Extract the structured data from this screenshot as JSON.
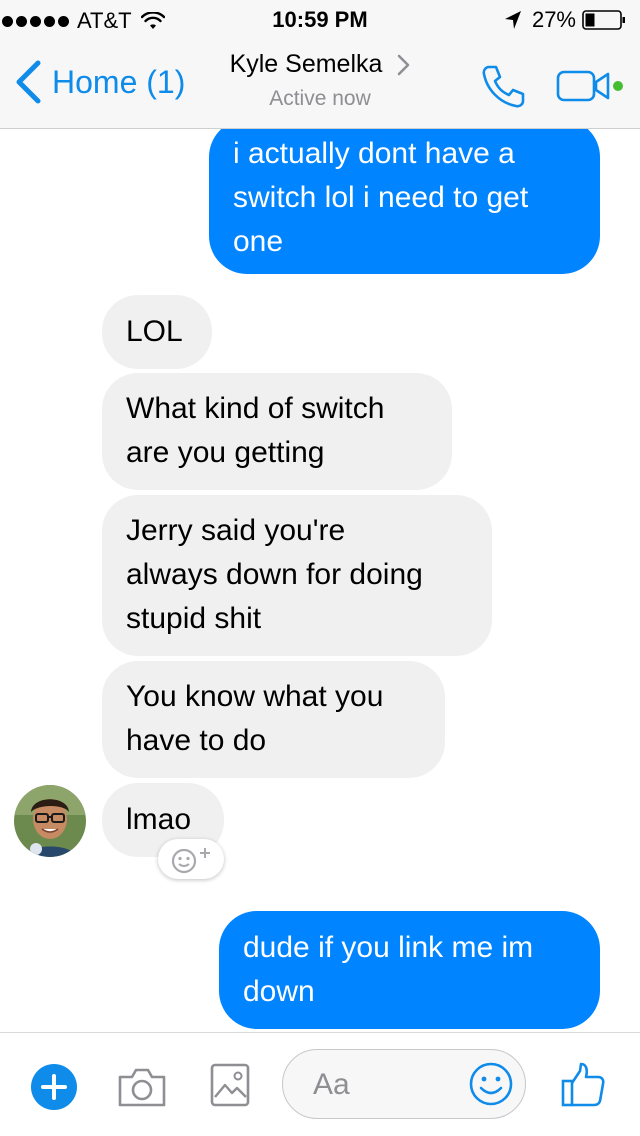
{
  "status_bar": {
    "carrier": "AT&T",
    "time": "10:59 PM",
    "battery_percent": "27%",
    "icons": [
      "signal-dots-icon",
      "wifi-icon",
      "location-arrow-icon",
      "battery-icon"
    ]
  },
  "nav": {
    "back_label": "Home (1)",
    "contact_name": "Kyle Semelka",
    "active_status": "Active now",
    "icons": [
      "chevron-left-icon",
      "chevron-right-icon",
      "phone-icon",
      "video-camera-icon"
    ],
    "accent_color": "#0f8bea",
    "online_dot_color": "#44bd32"
  },
  "messages": [
    {
      "direction": "outgoing",
      "lines": [
        "i actually dont have a",
        "switch lol i need to get",
        "one"
      ]
    },
    {
      "direction": "incoming",
      "lines": [
        "LOL"
      ]
    },
    {
      "direction": "incoming",
      "lines": [
        "What kind of switch",
        "are you getting"
      ]
    },
    {
      "direction": "incoming",
      "lines": [
        "Jerry said you're",
        "always down for doing",
        "stupid shit"
      ]
    },
    {
      "direction": "incoming",
      "lines": [
        "You know what you",
        "have to do"
      ]
    },
    {
      "direction": "incoming",
      "lines": [
        "lmao"
      ]
    },
    {
      "direction": "outgoing",
      "lines": [
        "dude if you link me im",
        "down"
      ]
    }
  ],
  "colors": {
    "outgoing_bubble": "#0084ff",
    "incoming_bubble": "#f1f0f0",
    "secondary_text": "#8e8e93"
  },
  "composer": {
    "placeholder": "Aa",
    "icons": [
      "plus-icon",
      "camera-icon",
      "photo-icon",
      "emoji-icon",
      "thumbs-up-icon"
    ]
  },
  "reaction": {
    "icon": "add-reaction-icon"
  }
}
